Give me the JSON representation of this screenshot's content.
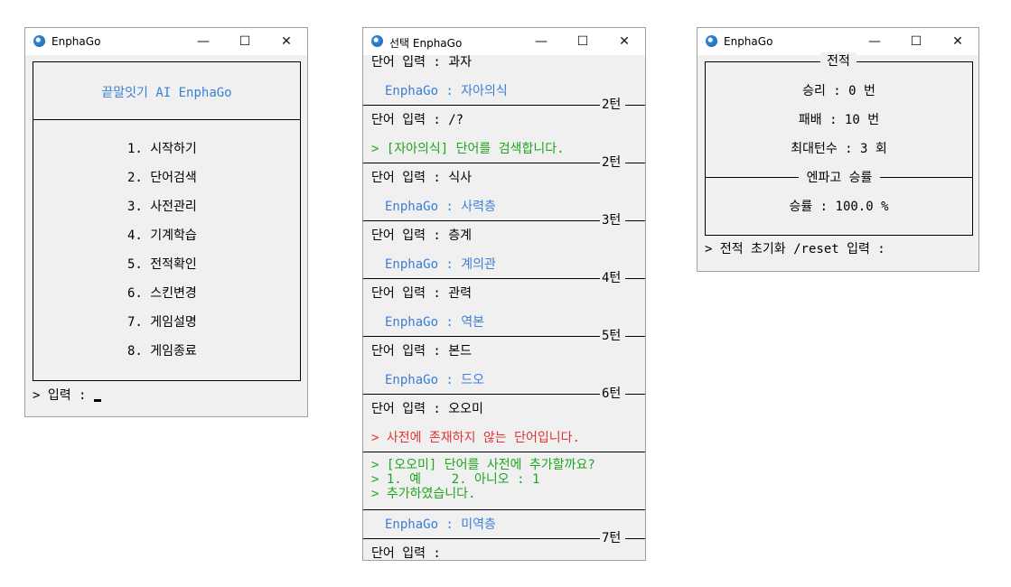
{
  "windows": {
    "menu": {
      "title": "EnphaGo",
      "header": "끝말잇기 AI EnphaGo",
      "items": [
        "1. 시작하기",
        "2. 단어검색",
        "3. 사전관리",
        "4. 기계학습",
        "5. 전적확인",
        "6. 스킨변경",
        "7. 게임설명",
        "8. 게임종료"
      ],
      "prompt": "> 입력 : "
    },
    "game": {
      "title": "선택 EnphaGo",
      "lines": {
        "l1": "단어 입력 : 과자",
        "l2": "EnphaGo : 자아의식",
        "t1": "2턴",
        "l3": "단어 입력 : /?",
        "l4": "> [자아의식] 단어를 검색합니다.",
        "t2": "2턴",
        "l5": "단어 입력 : 식사",
        "l6": "EnphaGo : 사력층",
        "t3": "3턴",
        "l7": "단어 입력 : 층계",
        "l8": "EnphaGo : 계의관",
        "t4": "4턴",
        "l9": "단어 입력 : 관력",
        "l10": "EnphaGo : 역본",
        "t5": "5턴",
        "l11": "단어 입력 : 본드",
        "l12": "EnphaGo : 드오",
        "t6": "6턴",
        "l13": "단어 입력 : 오오미",
        "l14": "> 사전에 존재하지 않는 단어입니다.",
        "l15": "> [오오미] 단어를 사전에 추가할까요?",
        "l16": "> 1. 예    2. 아니오 : 1",
        "l17": "> 추가하였습니다.",
        "l18": "EnphaGo : 미역층",
        "t7": "7턴",
        "l19": "단어 입력 : "
      }
    },
    "record": {
      "title": "EnphaGo",
      "section1": "전적",
      "wins": "승리 : 0 번",
      "losses": "패배 : 10 번",
      "max_turns": "최대턴수 : 3 회",
      "section2": "엔파고 승률",
      "win_rate": "승률 : 100.0 %",
      "prompt": "> 전적 초기화 /reset 입력 : "
    }
  },
  "controls": {
    "minimize": "—",
    "maximize": "☐",
    "close": "✕"
  },
  "colors": {
    "ai_text": "#3b7fd6",
    "system_text": "#1ea51e",
    "error_text": "#e23333"
  }
}
